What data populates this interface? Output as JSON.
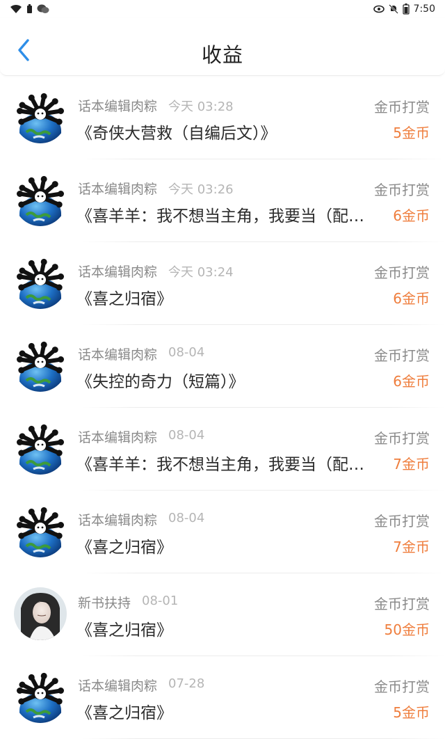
{
  "status_bar": {
    "time": "7:50"
  },
  "header": {
    "back_icon": "chevron-left-icon",
    "title": "收益",
    "accent_color": "#2e8ee8"
  },
  "rows": [
    {
      "avatar": "earth-bone-avatar",
      "name": "话本编辑肉粽",
      "time": "今天 03:28",
      "type": "金币打赏",
      "title": "《奇侠大营救（自编后文）》",
      "amount": "5金币"
    },
    {
      "avatar": "earth-bone-avatar",
      "name": "话本编辑肉粽",
      "time": "今天 03:26",
      "type": "金币打赏",
      "title": "《喜羊羊：我不想当主角，我要当（配角）》",
      "amount": "6金币"
    },
    {
      "avatar": "earth-bone-avatar",
      "name": "话本编辑肉粽",
      "time": "今天 03:24",
      "type": "金币打赏",
      "title": "《喜之归宿》",
      "amount": "6金币"
    },
    {
      "avatar": "earth-bone-avatar",
      "name": "话本编辑肉粽",
      "time": "08-04",
      "type": "金币打赏",
      "title": "《失控的奇力（短篇）》",
      "amount": "6金币"
    },
    {
      "avatar": "earth-bone-avatar",
      "name": "话本编辑肉粽",
      "time": "08-04",
      "type": "金币打赏",
      "title": "《喜羊羊：我不想当主角，我要当（配角）》",
      "amount": "7金币"
    },
    {
      "avatar": "earth-bone-avatar",
      "name": "话本编辑肉粽",
      "time": "08-04",
      "type": "金币打赏",
      "title": "《喜之归宿》",
      "amount": "7金币"
    },
    {
      "avatar": "portrait-avatar",
      "name": "新书扶持",
      "time": "08-01",
      "type": "金币打赏",
      "title": "《喜之归宿》",
      "amount": "50金币"
    },
    {
      "avatar": "earth-bone-avatar",
      "name": "话本编辑肉粽",
      "time": "07-28",
      "type": "金币打赏",
      "title": "《喜之归宿》",
      "amount": "5金币"
    }
  ],
  "colors": {
    "amount": "#ef7d3c",
    "secondary_text": "#8a8a8a",
    "time_text": "#b5b5b5"
  }
}
